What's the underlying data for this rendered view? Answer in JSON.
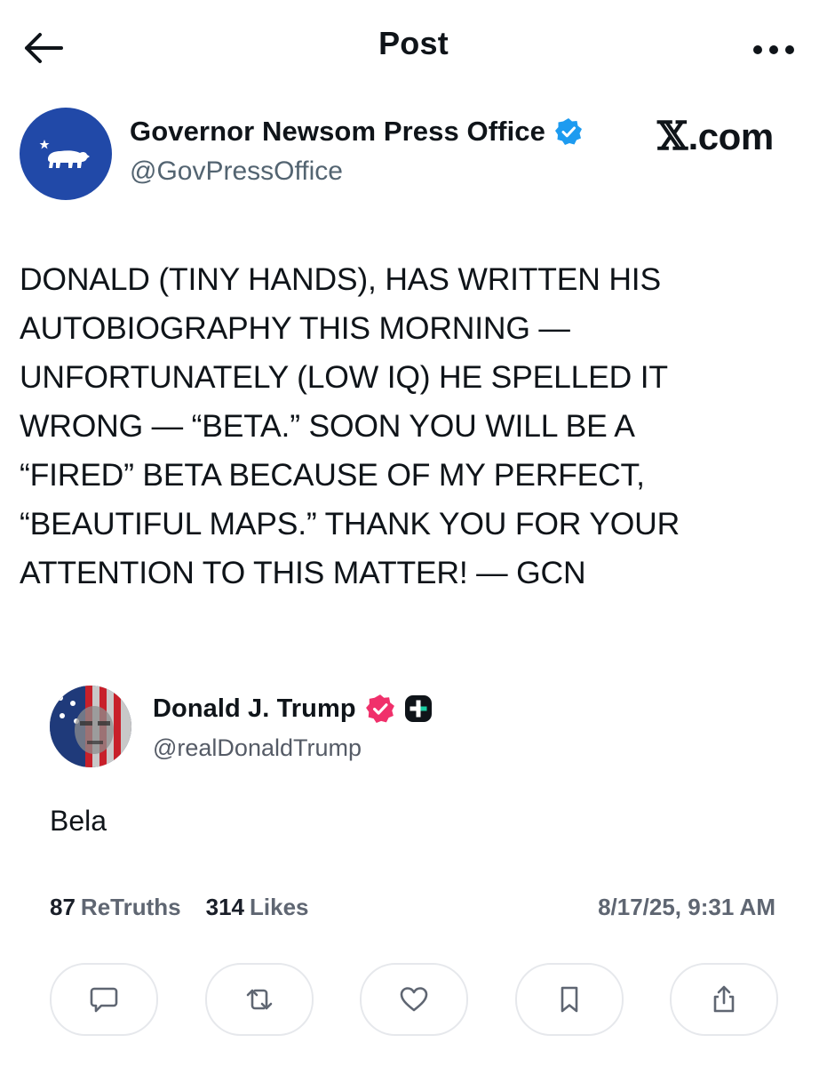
{
  "header": {
    "title": "Post",
    "back_icon": "arrow-left-icon",
    "more_icon": "more-horizontal-icon"
  },
  "author": {
    "name": "Governor Newsom Press Office",
    "handle": "@GovPressOffice",
    "verified_icon": "verified-badge-icon",
    "verified_color": "#1d9bf0",
    "avatar_color": "#2149a8"
  },
  "watermark": {
    "x_glyph": "𝕏",
    "text": ".com"
  },
  "post": {
    "lines": [
      "DONALD (TINY HANDS), HAS WRITTEN HIS",
      "AUTOBIOGRAPHY THIS MORNING —",
      "UNFORTUNATELY (LOW IQ) HE SPELLED IT",
      "WRONG — “BETA.” SOON YOU WILL BE A",
      "“FIRED” BETA BECAUSE OF MY PERFECT,",
      "“BEAUTIFUL MAPS.” THANK YOU FOR YOUR",
      "ATTENTION TO THIS MATTER! — GCN"
    ]
  },
  "embedded": {
    "name": "Donald J. Trump",
    "handle": "@realDonaldTrump",
    "verified_icon": "verified-badge-icon",
    "verified_color": "#f0306b",
    "plus_icon": "truth-plus-icon",
    "body": "Bela",
    "retruths_count": "87",
    "retruths_label": "ReTruths",
    "likes_count": "314",
    "likes_label": "Likes",
    "timestamp": "8/17/25, 9:31 AM"
  },
  "actions": [
    {
      "icon": "reply-icon"
    },
    {
      "icon": "retruth-icon"
    },
    {
      "icon": "like-icon"
    },
    {
      "icon": "bookmark-icon"
    },
    {
      "icon": "share-icon"
    }
  ]
}
